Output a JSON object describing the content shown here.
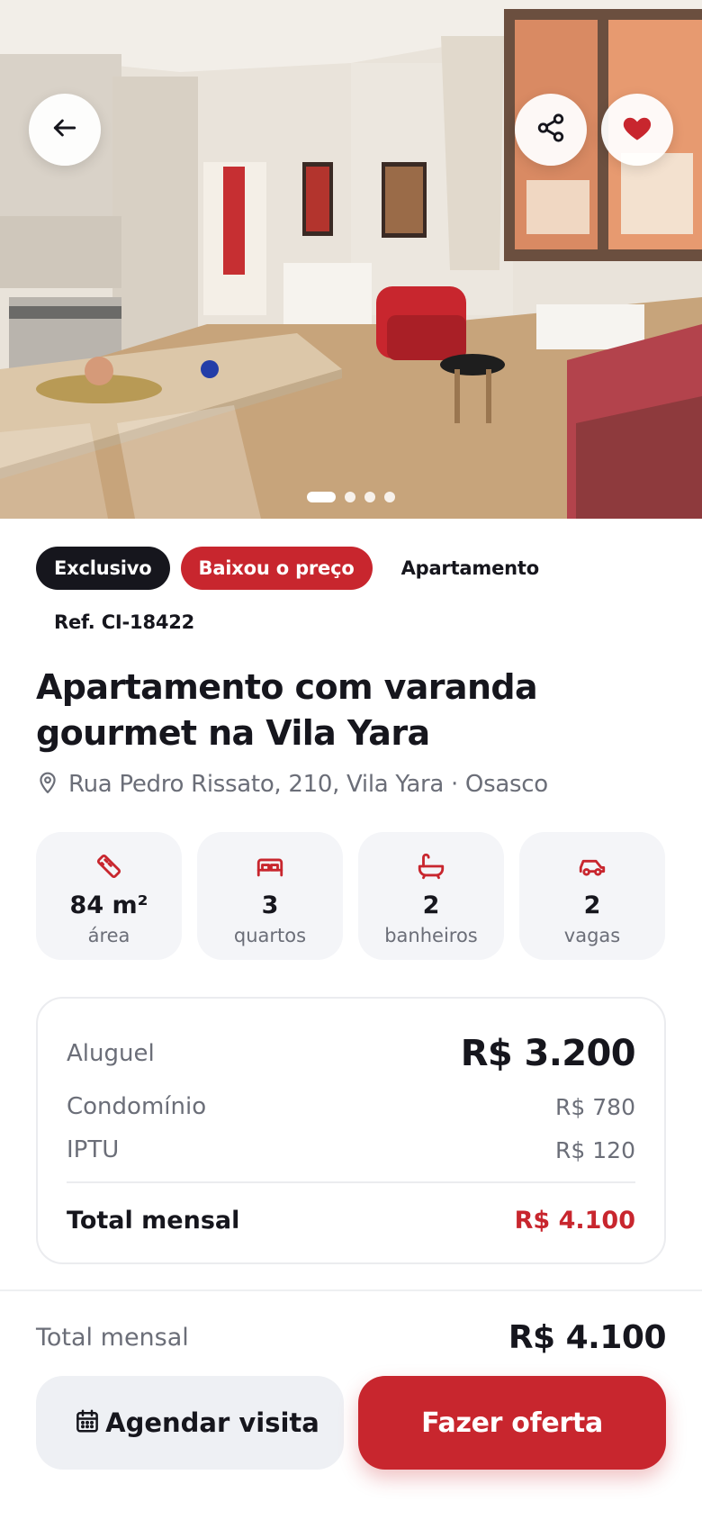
{
  "colors": {
    "accent": "#c8262e",
    "dark": "#16161d",
    "muted": "#6b6e78",
    "card_bg": "#f4f5f8"
  },
  "hero": {
    "image_description": "",
    "slide_count": 4,
    "active_slide": 1,
    "icons": {
      "back": "arrow-left-icon",
      "share": "share-icon",
      "favorite": "heart-filled-icon"
    },
    "favorite_active": true
  },
  "tags": [
    {
      "label": "Exclusivo",
      "style": "dark"
    },
    {
      "label": "Baixou o preço",
      "style": "red"
    },
    {
      "label": "Apartamento",
      "style": "plain"
    },
    {
      "label": "Ref. CI-18422",
      "style": "plain"
    }
  ],
  "listing": {
    "title": "Apartamento com varanda gourmet na Vila Yara",
    "address": "Rua Pedro Rissato, 210, Vila Yara · Osasco",
    "address_icon": "map-pin-icon"
  },
  "features": [
    {
      "icon": "ruler-icon",
      "value": "84 m²",
      "label": "área"
    },
    {
      "icon": "bed-icon",
      "value": "3",
      "label": "quartos"
    },
    {
      "icon": "bathtub-icon",
      "value": "2",
      "label": "banheiros"
    },
    {
      "icon": "car-icon",
      "value": "2",
      "label": "vagas"
    }
  ],
  "pricing": {
    "rent_label": "Aluguel",
    "rent_value": "R$ 3.200",
    "condo_label": "Condomínio",
    "condo_value": "R$ 780",
    "iptu_label": "IPTU",
    "iptu_value": "R$ 120",
    "total_label": "Total mensal",
    "total_value": "R$ 4.100"
  },
  "bottom_bar": {
    "total_label": "Total mensal",
    "total_value": "R$ 4.100",
    "schedule_label": "Agendar visita",
    "schedule_icon": "calendar-icon",
    "offer_label": "Fazer oferta"
  }
}
